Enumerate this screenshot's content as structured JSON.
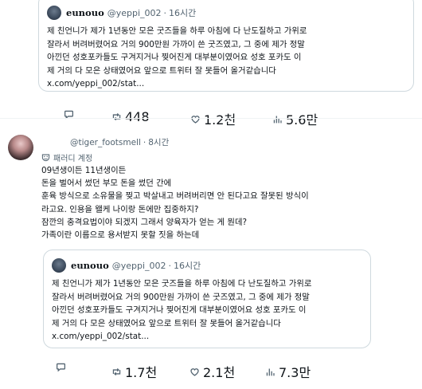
{
  "quoted_top": {
    "name": "eunouo",
    "handle": "@yeppi_002",
    "time": "16시간",
    "lines": [
      "제 친언니가 제가 1년동안 모은 굿즈들을 하루 아침에 다 난도질하고 가위로",
      "잘라서 버려버렸어요 거의 900만원 가까이 쓴 굿즈였고, 그 중에 제가 정말",
      "아낀던 성호포카들도 구겨지거나 찢어진게 대부분이였어요 성호 포카도 이",
      "제 거의 다 모은 상태였어요 앞으로 트위터 잘 못들어 올거같습니다",
      "x.com/yeppi_002/stat..."
    ]
  },
  "top_actions": {
    "replies": "",
    "reposts": "448",
    "likes": "1.2천",
    "views": "5.6만"
  },
  "post": {
    "handle": "@tiger_footsmell",
    "time": "8시간",
    "parody_label": "패러디 계정",
    "lines": [
      "09년생이든 11년생이든",
      "돈을 벌어서 썼던 부모 돈을 썼던 간에",
      "훈육 방식으로 소유물을 찢고 박살내고 버려버리면 안 된다고요 잘못된 방식이",
      "라고요. 인용을 왤케 나이랑 돈에만 집중하지?",
      "잠깐의 충격요법이야 되겠지 그래서 양육자가 얻는 게 뭔데?",
      "가족이란 이름으로 용서받지 못할 짓을 하는데"
    ]
  },
  "quoted_inner": {
    "name": "eunouo",
    "handle": "@yeppi_002",
    "time": "16시간",
    "lines": [
      "제 친언니가 제가 1년동안 모은 굿즈들을 하루 아침에 다 난도질하고 가위로",
      "잘라서 버려버렸어요 거의 900만원 가까이 쓴 굿즈였고, 그 중에 제가 정말",
      "아낀던 성호포카들도 구겨지거나 찢어진게 대부분이였어요 성호 포카도 이",
      "제 거의 다 모은 상태였어요 앞으로 트위터 잘 못들어 올거같습니다",
      "x.com/yeppi_002/stat..."
    ]
  },
  "bottom_actions": {
    "replies": "",
    "reposts": "1.7천",
    "likes": "2.1천",
    "views": "7.3만"
  },
  "icons": {
    "reply": "speech-bubble-icon",
    "repost": "repost-arrows-icon",
    "like": "heart-icon",
    "views": "bar-chart-icon",
    "parody": "theater-mask-icon"
  }
}
